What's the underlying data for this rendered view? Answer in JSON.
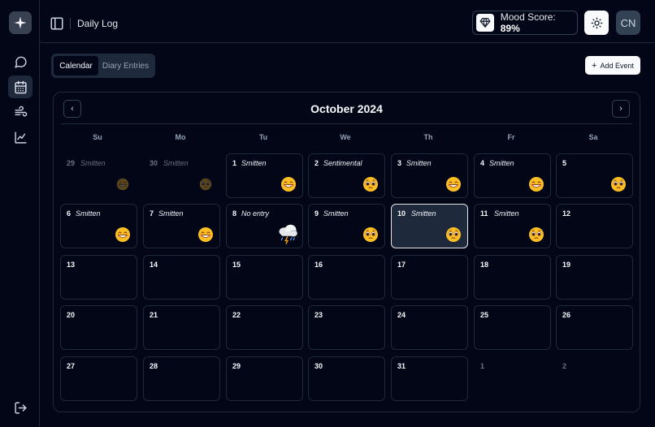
{
  "header": {
    "page_title": "Daily Log",
    "mood_label": "Mood Score:",
    "mood_value": "89%",
    "avatar_initials": "CN"
  },
  "sidebar": {
    "items": [
      {
        "name": "chat",
        "icon": "message-circle-icon"
      },
      {
        "name": "calendar",
        "icon": "calendar-icon",
        "active": true
      },
      {
        "name": "wind",
        "icon": "wind-icon"
      },
      {
        "name": "chart",
        "icon": "line-chart-icon"
      }
    ],
    "logout_icon": "log-out-icon"
  },
  "tabs": [
    {
      "label": "Calendar",
      "active": true
    },
    {
      "label": "Diary Entries",
      "active": false
    }
  ],
  "add_event_label": "Add Event",
  "calendar": {
    "month_title": "October 2024",
    "weekdays": [
      "Su",
      "Mo",
      "Tu",
      "We",
      "Th",
      "Fr",
      "Sa"
    ],
    "weeks": [
      [
        {
          "day": "29",
          "mood": "Smitten",
          "emoji": "grin",
          "outside": true
        },
        {
          "day": "30",
          "mood": "Smitten",
          "emoji": "pleading",
          "outside": true
        },
        {
          "day": "1",
          "mood": "Smitten",
          "emoji": "grin"
        },
        {
          "day": "2",
          "mood": "Sentimental",
          "emoji": "pleading"
        },
        {
          "day": "3",
          "mood": "Smitten",
          "emoji": "grin"
        },
        {
          "day": "4",
          "mood": "Smitten",
          "emoji": "grin"
        },
        {
          "day": "5",
          "mood": "",
          "emoji": "pleading"
        }
      ],
      [
        {
          "day": "6",
          "mood": "Smitten",
          "emoji": "grin"
        },
        {
          "day": "7",
          "mood": "Smitten",
          "emoji": "grin"
        },
        {
          "day": "8",
          "mood": "No entry",
          "emoji": "storm"
        },
        {
          "day": "9",
          "mood": "Smitten",
          "emoji": "pleading"
        },
        {
          "day": "10",
          "mood": "Smitten",
          "emoji": "pleading",
          "selected": true
        },
        {
          "day": "11",
          "mood": "Smitten",
          "emoji": "pleading"
        },
        {
          "day": "12",
          "mood": "",
          "emoji": ""
        }
      ],
      [
        {
          "day": "13"
        },
        {
          "day": "14"
        },
        {
          "day": "15"
        },
        {
          "day": "16"
        },
        {
          "day": "17"
        },
        {
          "day": "18"
        },
        {
          "day": "19"
        }
      ],
      [
        {
          "day": "20"
        },
        {
          "day": "21"
        },
        {
          "day": "22"
        },
        {
          "day": "23"
        },
        {
          "day": "24"
        },
        {
          "day": "25"
        },
        {
          "day": "26"
        }
      ],
      [
        {
          "day": "27"
        },
        {
          "day": "28"
        },
        {
          "day": "29"
        },
        {
          "day": "30"
        },
        {
          "day": "31"
        },
        {
          "day": "1",
          "outside": true
        },
        {
          "day": "2",
          "outside": true
        }
      ]
    ]
  },
  "colors": {
    "background": "#020617",
    "border": "#1e293b",
    "selected_bg": "#1e293b",
    "emoji_yellow": "#fbbf24"
  }
}
